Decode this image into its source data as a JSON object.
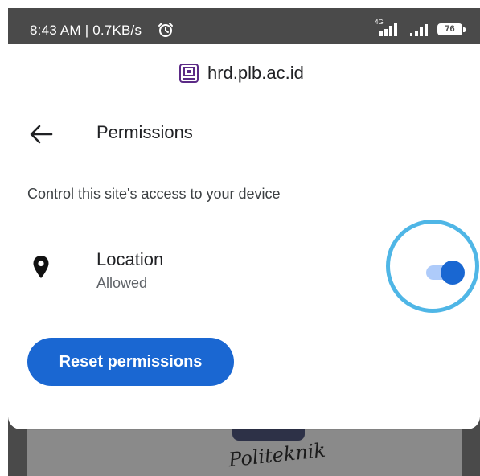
{
  "status_bar": {
    "text": "8:43 AM | 0.7KB/s",
    "network": "4G",
    "battery": "76",
    "icons": [
      "alarm-icon",
      "signal-icon",
      "signal-icon",
      "battery-icon"
    ]
  },
  "sheet": {
    "site": "hrd.plb.ac.id",
    "title": "Permissions",
    "subtitle": "Control this site's access to your device",
    "permissions": [
      {
        "label": "Location",
        "status": "Allowed",
        "icon": "location-pin-icon",
        "enabled": true
      }
    ],
    "reset_label": "Reset permissions",
    "colors": {
      "accent": "#1a67d2",
      "toggle_track": "#aecbfa",
      "highlight": "#4fb6e6"
    }
  },
  "background": {
    "logo_text": "Politeknik"
  }
}
